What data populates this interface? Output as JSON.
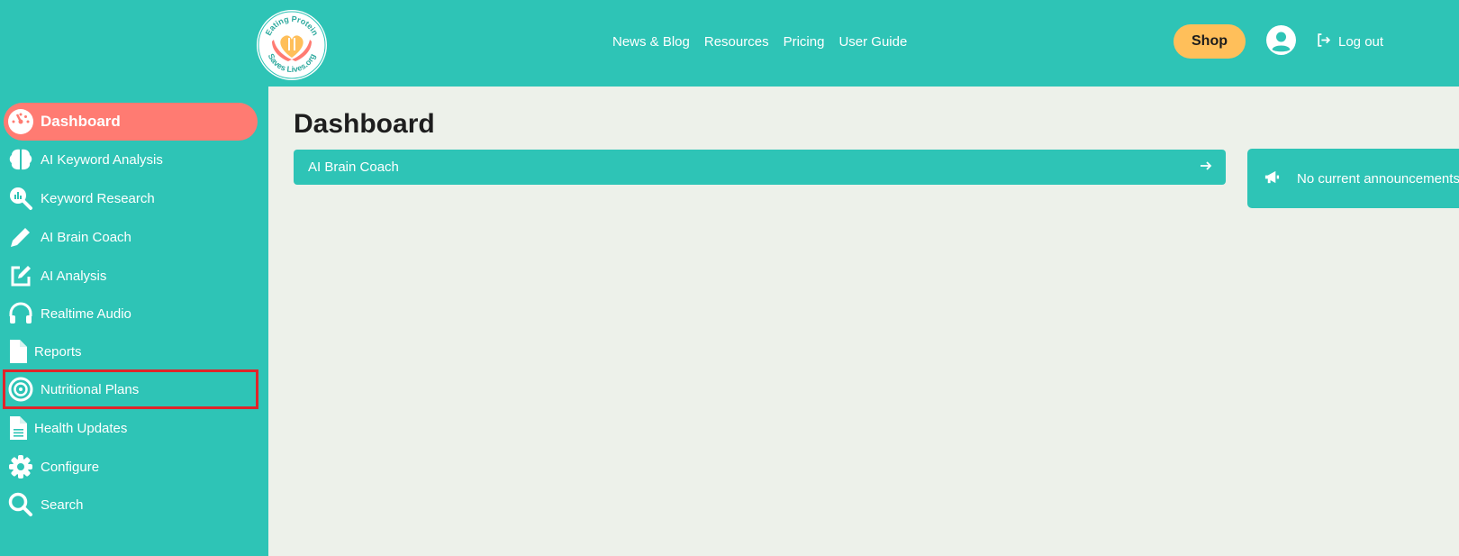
{
  "header": {
    "logo_text_top": "Eating Protein",
    "logo_text_bottom": "Saves Lives.org",
    "nav": [
      {
        "label": "News & Blog"
      },
      {
        "label": "Resources"
      },
      {
        "label": "Pricing"
      },
      {
        "label": "User Guide"
      }
    ],
    "shop_label": "Shop",
    "logout_label": "Log out"
  },
  "sidebar": {
    "items": [
      {
        "label": "Dashboard",
        "icon": "gauge-icon",
        "active": true
      },
      {
        "label": "AI Keyword Analysis",
        "icon": "brain-icon"
      },
      {
        "label": "Keyword Research",
        "icon": "magnifier-chart-icon"
      },
      {
        "label": "AI Brain Coach",
        "icon": "pencil-icon"
      },
      {
        "label": "AI Analysis",
        "icon": "edit-square-icon"
      },
      {
        "label": "Realtime Audio",
        "icon": "headphones-icon"
      },
      {
        "label": "Reports",
        "icon": "file-icon"
      },
      {
        "label": "Nutritional Plans",
        "icon": "target-icon",
        "highlighted": true
      },
      {
        "label": "Health Updates",
        "icon": "file-lines-icon"
      },
      {
        "label": "Configure",
        "icon": "gear-icon"
      },
      {
        "label": "Search",
        "icon": "search-icon"
      }
    ]
  },
  "main": {
    "title": "Dashboard",
    "coach_bar_label": "AI Brain Coach",
    "announcement_text": "No current announcements"
  },
  "colors": {
    "teal": "#2ec4b6",
    "active_item": "#ff7b72",
    "shop_button": "#ffbf5a",
    "highlight_outline": "#e0242a",
    "main_background": "#edf1ea"
  }
}
